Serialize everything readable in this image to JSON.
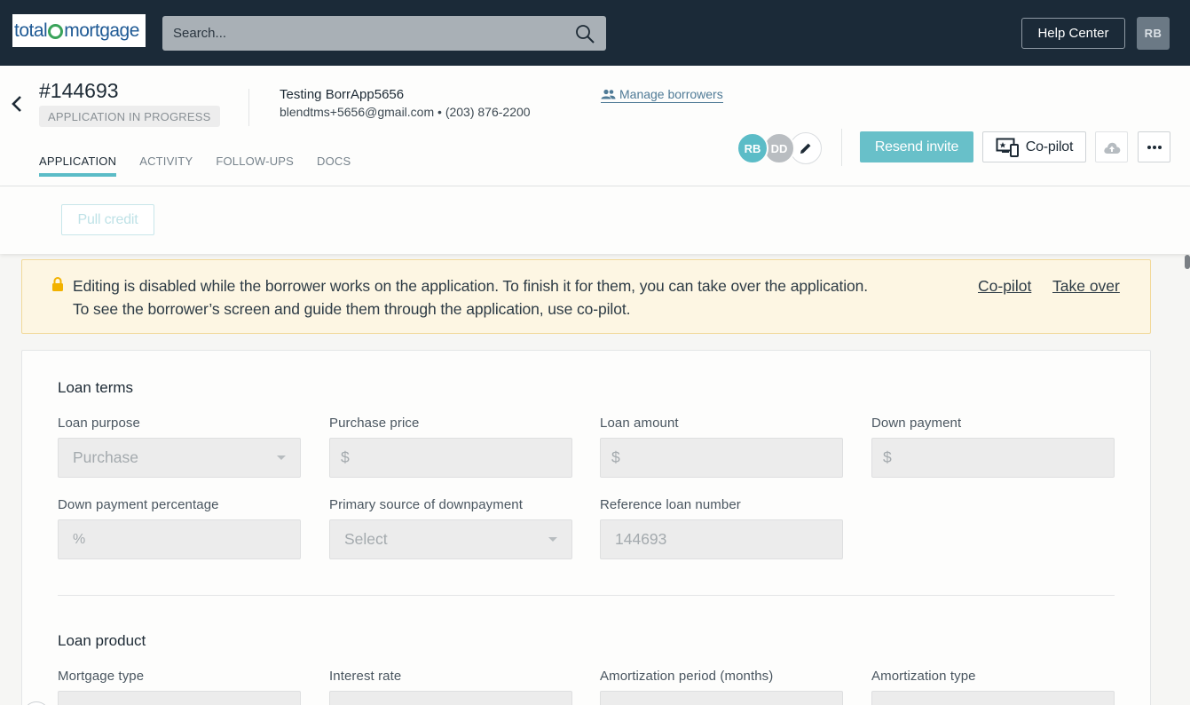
{
  "topbar": {
    "logo_text_1": "total",
    "logo_text_2": "mortgage",
    "search_placeholder": "Search...",
    "help_center": "Help Center",
    "user_initials": "RB"
  },
  "header": {
    "loan_number": "#144693",
    "status": "APPLICATION IN PROGRESS",
    "borrower_name": "Testing BorrApp5656",
    "borrower_contact": "blendtms+5656@gmail.com • (203) 876-2200",
    "manage_borrowers": "Manage borrowers",
    "tabs": [
      "APPLICATION",
      "ACTIVITY",
      "FOLLOW-UPS",
      "DOCS"
    ],
    "active_tab": "APPLICATION",
    "borrower_avatars": [
      "RB",
      "DD"
    ],
    "resend_invite": "Resend invite",
    "copilot": "Co-pilot",
    "accent_color": "#5bbcc7"
  },
  "actions": {
    "pull_credit": "Pull credit"
  },
  "notice": {
    "line1": "Editing is disabled while the borrower works on the application. To finish it for them, you can take over the application.",
    "line2": "To see the borrower’s screen and guide them through the application, use co-pilot.",
    "link_copilot": "Co-pilot",
    "link_takeover": "Take over"
  },
  "loan_terms": {
    "title": "Loan terms",
    "fields": [
      {
        "label": "Loan purpose",
        "value": "Purchase",
        "type": "select"
      },
      {
        "label": "Purchase price",
        "value": "$",
        "type": "currency"
      },
      {
        "label": "Loan amount",
        "value": "$",
        "type": "currency"
      },
      {
        "label": "Down payment",
        "value": "$",
        "type": "currency"
      },
      {
        "label": "Down payment percentage",
        "value": "%",
        "type": "percent"
      },
      {
        "label": "Primary source of downpayment",
        "value": "Select",
        "type": "select"
      },
      {
        "label": "Reference loan number",
        "value": "144693",
        "type": "text"
      }
    ]
  },
  "loan_product": {
    "title": "Loan product",
    "fields": [
      {
        "label": "Mortgage type"
      },
      {
        "label": "Interest rate"
      },
      {
        "label": "Amortization period (months)"
      },
      {
        "label": "Amortization type"
      }
    ]
  }
}
